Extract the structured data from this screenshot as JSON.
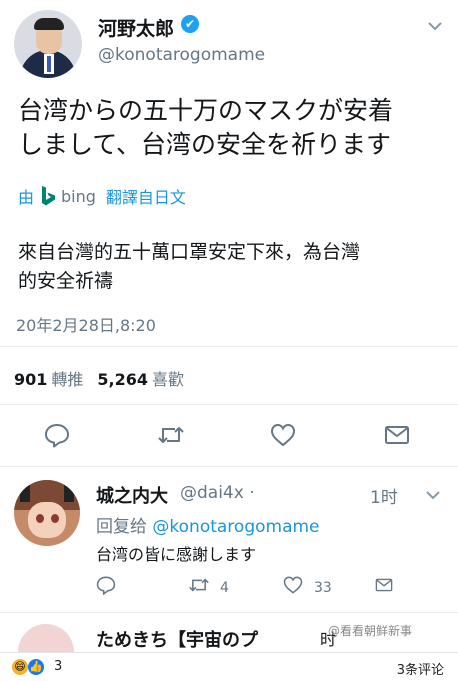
{
  "tweet": {
    "author_name": "河野太郎",
    "handle": "@konotarogomame",
    "verified_mark": "✔",
    "text_line1": "台湾からの五十万のマスクが安着",
    "text_line2": "しまして、台湾の安全を祈ります",
    "translate_prefix": "由",
    "translate_brand": "bing",
    "translate_label": "翻譯自日文",
    "translated_line1": "來自台灣的五十萬口罩安定下來，為台灣",
    "translated_line2": "的安全祈禱",
    "timestamp": "20年2月28日,8:20",
    "retweet_count": "901",
    "retweet_label": "轉推",
    "like_count": "5,264",
    "like_label": "喜歡"
  },
  "reply": {
    "author_name": "城之内大",
    "handle": "@dai4x ·",
    "time": "1时",
    "reply_prefix": "回复给",
    "reply_mention": "@konotarogomame",
    "text": "台湾の皆に感謝します",
    "retweet_count": "4",
    "like_count": "33"
  },
  "peek": {
    "name_partial": "ためきち【宇宙のプ",
    "right_partial": "时"
  },
  "watermark": "@看看朝鲜新事",
  "bottom_bar": {
    "reaction_count": "3",
    "comment_count": "3条评论"
  },
  "icons": {
    "reply": "reply-icon",
    "retweet": "retweet-icon",
    "like": "heart-icon",
    "share": "share-icon",
    "chevron": "chevron-down-icon",
    "verified": "verified-badge-icon"
  },
  "colors": {
    "accent": "#1b95e0",
    "muted": "#657786",
    "text": "#14171a",
    "verified": "#1da1f2"
  }
}
